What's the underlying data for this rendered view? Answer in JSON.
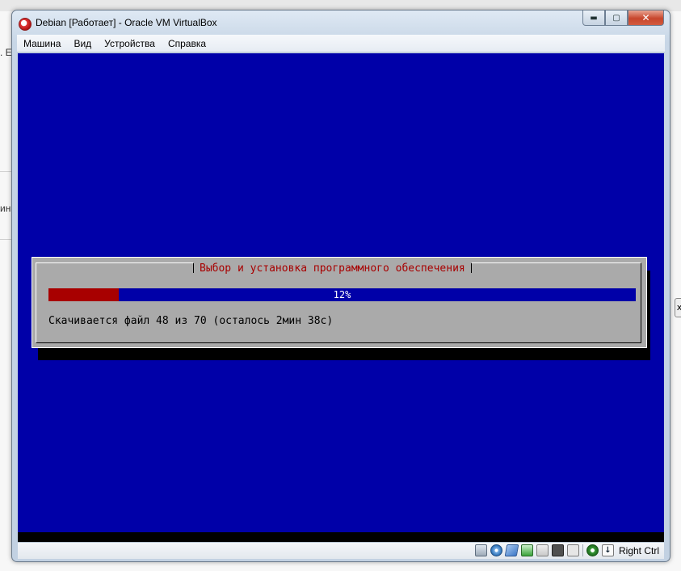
{
  "window": {
    "title": "Debian [Работает] - Oracle VM VirtualBox",
    "min_glyph": "▬",
    "max_glyph": "▢",
    "close_glyph": "✕"
  },
  "menu": {
    "items": [
      {
        "label": "Машина"
      },
      {
        "label": "Вид"
      },
      {
        "label": "Устройства"
      },
      {
        "label": "Справка"
      }
    ]
  },
  "dialog": {
    "title": "Выбор и установка программного обеспечения",
    "progress_percent": 12,
    "progress_label": "12%",
    "status_text": "Скачивается файл 48 из 70 (осталось 2мин 38с)"
  },
  "statusbar": {
    "host_key": "Right Ctrl",
    "icons": [
      "hard-disk-icon",
      "optical-drive-icon",
      "usb-icon",
      "network-icon",
      "shared-folders-icon",
      "video-capture-icon",
      "floppy-icon",
      "virtualization-icon",
      "mouse-integration-icon"
    ]
  },
  "background": {
    "fragment_1": ". Е",
    "fragment_2": "ин",
    "fragment_3": "х"
  },
  "colors": {
    "vm_background": "#0000a8",
    "dialog_bg": "#aaaaaa",
    "dialog_title": "#a80000",
    "progress_fill": "#a80000"
  }
}
